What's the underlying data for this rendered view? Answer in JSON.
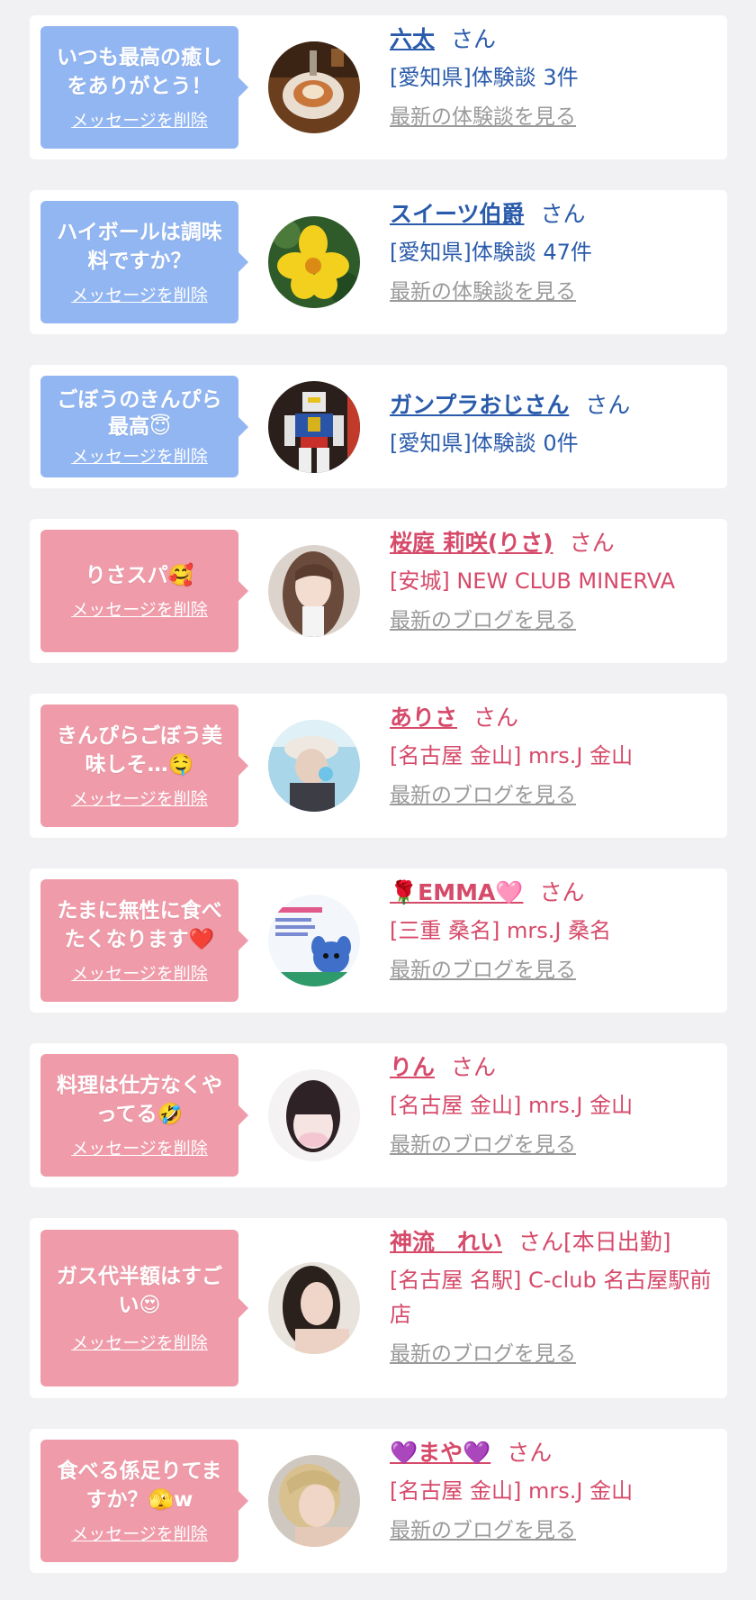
{
  "cards": [
    {
      "message": "いつも最高の癒しをありがとう！",
      "delete_label": "メッセージを削除",
      "name": "六太",
      "san": "さん",
      "detail": "[愛知県]体験談 3件",
      "link": "最新の体験談を見る",
      "theme": "#92b6f2",
      "avatar": "food-photo-avatar"
    },
    {
      "message": "ハイボールは調味料ですか？",
      "delete_label": "メッセージを削除",
      "name": "スイーツ伯爵",
      "san": "さん",
      "detail": "[愛知県]体験談 47件",
      "link": "最新の体験談を見る",
      "theme": "#92b6f2",
      "avatar": "yellow-flower-avatar"
    },
    {
      "message": "ごぼうのきんぴら最高😇",
      "delete_label": "メッセージを削除",
      "name": "ガンプラおじさん",
      "san": "さん",
      "detail": "[愛知県]体験談 0件",
      "link": "",
      "theme": "#92b6f2",
      "avatar": "robot-figure-avatar"
    },
    {
      "message": "りさスパ🥰",
      "delete_label": "メッセージを削除",
      "name": "桜庭 莉咲(りさ)",
      "san": "さん",
      "detail": "[安城] NEW CLUB MINERVA",
      "link": "最新のブログを見る",
      "theme": "#ef9ba9",
      "avatar": "woman-portrait-avatar"
    },
    {
      "message": "きんぴらごぼう美味しそ…🤤",
      "delete_label": "メッセージを削除",
      "name": "ありさ",
      "san": "さん",
      "detail": "[名古屋 金山] mrs.J 金山",
      "link": "最新のブログを見る",
      "theme": "#ef9ba9",
      "avatar": "woman-cap-avatar"
    },
    {
      "message": "たまに無性に食べたくなります❤️",
      "delete_label": "メッセージを削除",
      "name": "🌹EMMA🩷",
      "san": "さん",
      "detail": "[三重 桑名] mrs.J 桑名",
      "link": "最新のブログを見る",
      "theme": "#ef9ba9",
      "avatar": "stitch-card-avatar"
    },
    {
      "message": "料理は仕方なくやってる🤣",
      "delete_label": "メッセージを削除",
      "name": "りん",
      "san": "さん",
      "detail": "[名古屋 金山] mrs.J 金山",
      "link": "最新のブログを見る",
      "theme": "#ef9ba9",
      "avatar": "woman-bangs-avatar"
    },
    {
      "message": "ガス代半額はすごい😍",
      "delete_label": "メッセージを削除",
      "name": "神流　れい",
      "san": "さん[本日出勤]",
      "detail": "[名古屋 名駅] C-club 名古屋駅前店",
      "link": "最新のブログを見る",
      "theme": "#ef9ba9",
      "avatar": "woman-dark-hair-avatar"
    },
    {
      "message": "食べる係足りてますか？🫣w",
      "delete_label": "メッセージを削除",
      "name": "💜まや💜",
      "san": "さん",
      "detail": "[名古屋 金山] mrs.J 金山",
      "link": "最新のブログを見る",
      "theme": "#ef9ba9",
      "avatar": "woman-blonde-avatar"
    }
  ]
}
